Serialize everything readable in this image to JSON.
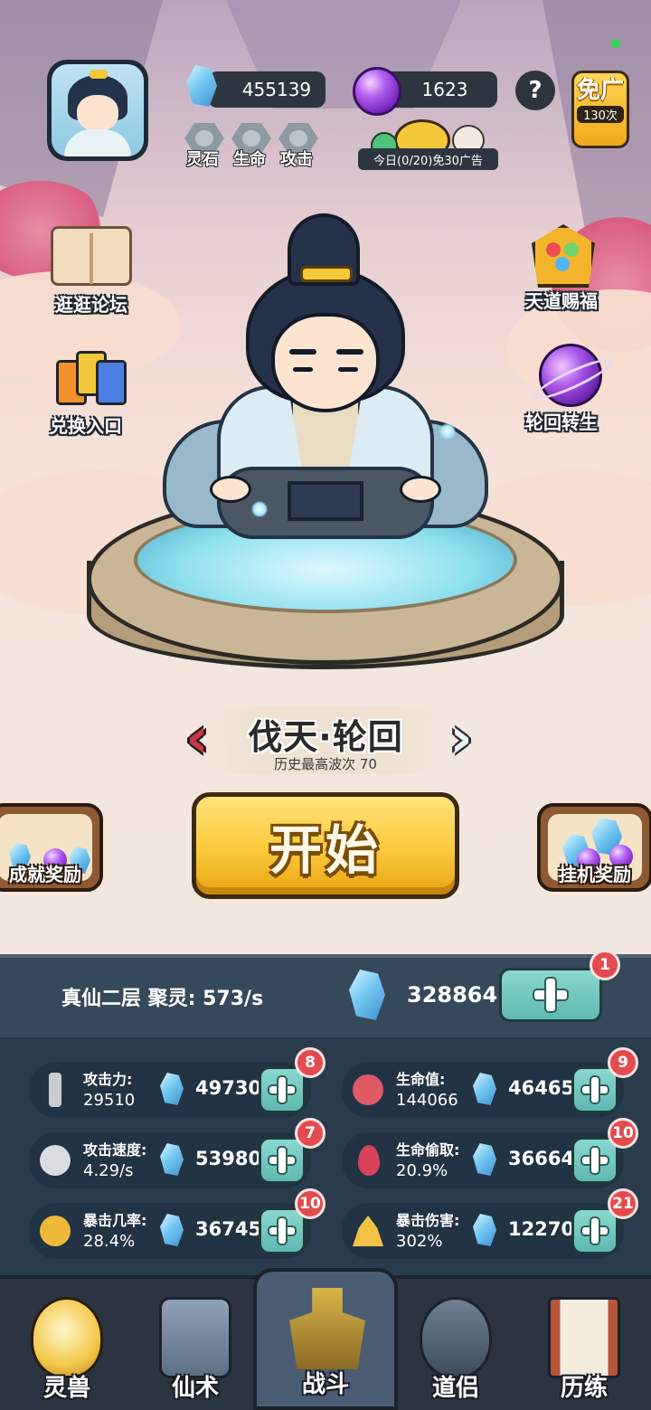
{
  "top_bar": {
    "spirit_stone": "455139",
    "purple_gem": "1623",
    "help_label": "?",
    "ad_free": {
      "label": "免广",
      "count": "130次"
    },
    "daily_ad_note": "今日(0/20)免30广告",
    "slots": [
      "灵石",
      "生命",
      "攻击"
    ]
  },
  "side_buttons": {
    "forum": "逛逛论坛",
    "redeem": "兑换入口",
    "blessing": "天道赐福",
    "rebirth": "轮回转生"
  },
  "stage": {
    "title": "伐天·轮回",
    "record": "历史最高波次 70"
  },
  "actions": {
    "start": "开始",
    "achievement": "成就奖励",
    "idle": "挂机奖励"
  },
  "realm": {
    "label": "真仙二层 聚灵: 573/s",
    "stones": "328864",
    "badge": "1"
  },
  "stats": [
    {
      "name": "攻击力:",
      "value": "29510",
      "cost": "49730",
      "badge": "8",
      "icon": "sword-icon"
    },
    {
      "name": "生命值:",
      "value": "144066",
      "cost": "46465",
      "badge": "9",
      "icon": "heart-icon"
    },
    {
      "name": "攻击速度:",
      "value": "4.29/s",
      "cost": "53980",
      "badge": "7",
      "icon": "wings-icon"
    },
    {
      "name": "生命偷取:",
      "value": "20.9%",
      "cost": "36664",
      "badge": "10",
      "icon": "blood-drop-icon"
    },
    {
      "name": "暴击几率:",
      "value": "28.4%",
      "cost": "36745",
      "badge": "10",
      "icon": "feather-icon"
    },
    {
      "name": "暴击伤害:",
      "value": "302%",
      "cost": "12270",
      "badge": "21",
      "icon": "flame-icon"
    }
  ],
  "tabs": [
    "灵兽",
    "仙术",
    "战斗",
    "道侣",
    "历练"
  ],
  "colors": {
    "panel": "#2a3c4c",
    "plus_button": "#5fb9b0",
    "badge": "#e34b4f",
    "start_button": "#fbc93b"
  }
}
